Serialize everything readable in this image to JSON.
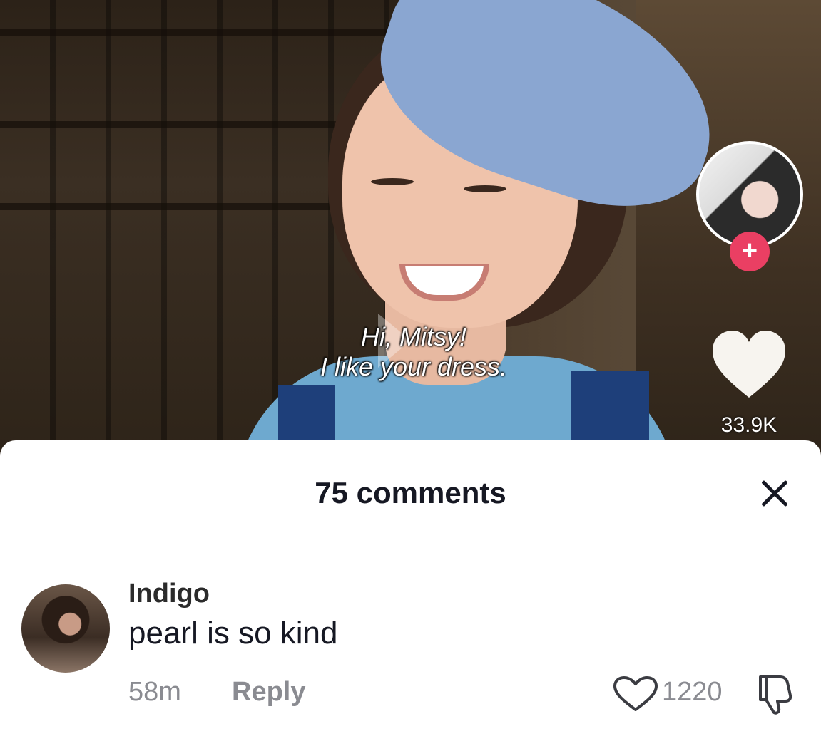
{
  "video": {
    "subtitle_line1": "Hi, Mitsy!",
    "subtitle_line2": "I like your dress.",
    "like_count": "33.9K",
    "follow_symbol": "+"
  },
  "comments_sheet": {
    "title": "75 comments",
    "close_icon": "close-icon",
    "comments": [
      {
        "username": "Indigo",
        "text": "pearl is so kind",
        "time": "58m",
        "reply_label": "Reply",
        "like_count": "1220"
      }
    ]
  },
  "colors": {
    "follow_accent": "#ea3f63",
    "text_primary": "#161823",
    "text_secondary": "#8a8b91"
  }
}
